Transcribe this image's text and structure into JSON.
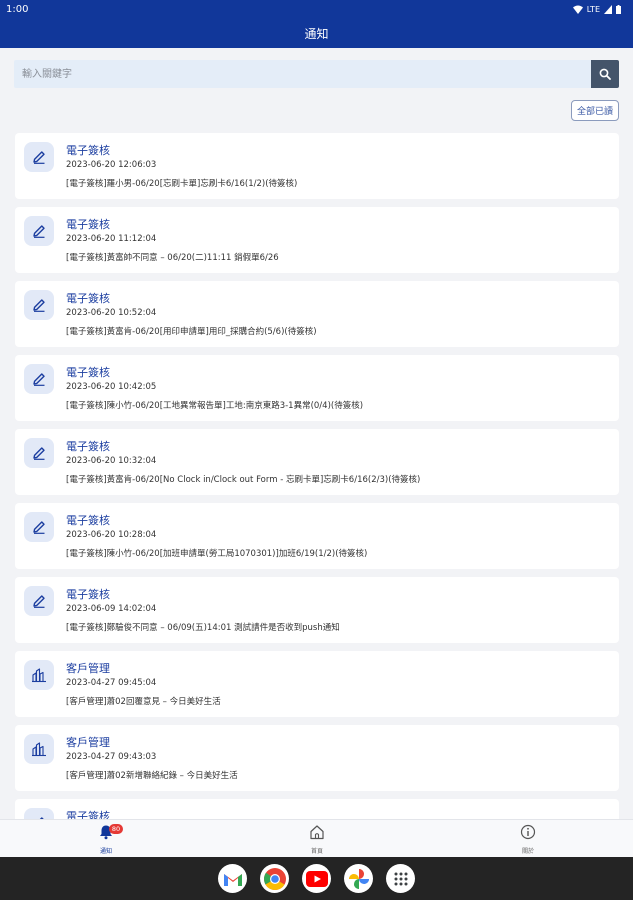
{
  "status_bar": {
    "time": "1:00",
    "network": "LTE"
  },
  "app_bar": {
    "title": "通知"
  },
  "search": {
    "placeholder": "輸入關鍵字"
  },
  "mark_all_read_label": "全部已讀",
  "notifications": [
    {
      "icon": "pen-icon",
      "title": "電子簽核",
      "time": "2023-06-20 12:06:03",
      "desc": "[電子簽核]羅小男-06/20[忘刷卡單]忘刷卡6/16(1/2)(待簽核)"
    },
    {
      "icon": "pen-icon",
      "title": "電子簽核",
      "time": "2023-06-20 11:12:04",
      "desc": "[電子簽核]黃富帥不同意 – 06/20(二)11:11 銷假單6/26"
    },
    {
      "icon": "pen-icon",
      "title": "電子簽核",
      "time": "2023-06-20 10:52:04",
      "desc": "[電子簽核]黃富肯-06/20[用印申請單]用印_採購合約(5/6)(待簽核)"
    },
    {
      "icon": "pen-icon",
      "title": "電子簽核",
      "time": "2023-06-20 10:42:05",
      "desc": "[電子簽核]陳小竹-06/20[工地異常報告單]工地:南京東路3-1異常(0/4)(待簽核)"
    },
    {
      "icon": "pen-icon",
      "title": "電子簽核",
      "time": "2023-06-20 10:32:04",
      "desc": "[電子簽核]黃富肯-06/20[No Clock in/Clock out Form - 忘刷卡單]忘刷卡6/16(2/3)(待簽核)"
    },
    {
      "icon": "pen-icon",
      "title": "電子簽核",
      "time": "2023-06-20 10:28:04",
      "desc": "[電子簽核]陳小竹-06/20[加班申請單(勞工局1070301)]加班6/19(1/2)(待簽核)"
    },
    {
      "icon": "pen-icon",
      "title": "電子簽核",
      "time": "2023-06-09 14:02:04",
      "desc": "[電子簽核]鄭驗俊不同意 – 06/09(五)14:01 測試請件是否收到push通知"
    },
    {
      "icon": "buildings-icon",
      "title": "客戶管理",
      "time": "2023-04-27 09:45:04",
      "desc": "[客戶管理]蕭02回覆意見 – 今日美好生活"
    },
    {
      "icon": "buildings-icon",
      "title": "客戶管理",
      "time": "2023-04-27 09:43:03",
      "desc": "[客戶管理]蕭02新增聯絡紀錄 – 今日美好生活"
    },
    {
      "icon": "pen-icon",
      "title": "電子簽核",
      "time": "",
      "desc": ""
    }
  ],
  "bottom_nav": {
    "notifications": {
      "label": "通知",
      "badge": "80"
    },
    "home": {
      "label": "首頁"
    },
    "about": {
      "label": "關於"
    }
  },
  "dock_apps": [
    "gmail-icon",
    "chrome-icon",
    "youtube-icon",
    "photos-icon",
    "apps-grid-icon"
  ]
}
